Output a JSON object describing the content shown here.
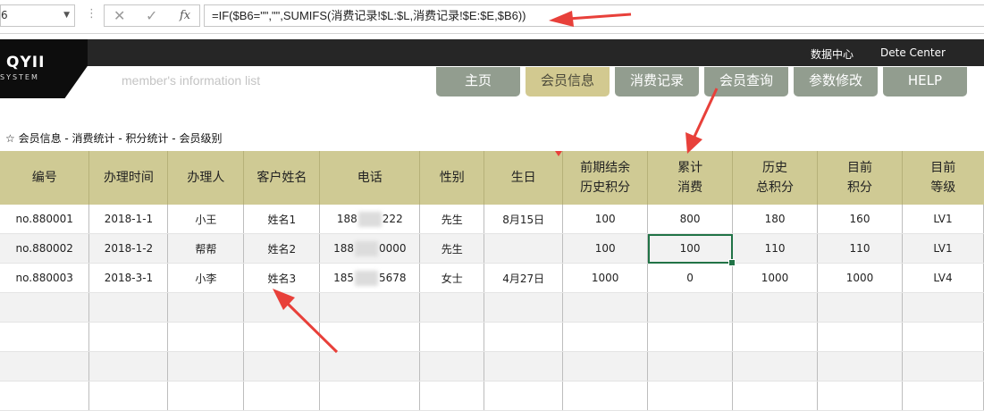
{
  "formula_bar": {
    "namebox_value": "6",
    "fx_label": "fx",
    "formula": "=IF($B6=\"\",\"\",SUMIFS(消费记录!$L:$L,消费记录!$E:$E,$B6))"
  },
  "header": {
    "logo_main": "QYII",
    "logo_sub": "SYSTEM",
    "links": [
      "数据中心",
      "Dete Center"
    ],
    "subtitle": "member's information list"
  },
  "nav": {
    "items": [
      "主页",
      "会员信息",
      "消费记录",
      "会员查询",
      "参数修改",
      "HELP"
    ],
    "active": "会员信息"
  },
  "breadcrumb": "☆  会员信息 - 消费统计 - 积分统计 - 会员级别",
  "table": {
    "columns": [
      "编号",
      "办理时间",
      "办理人",
      "客户姓名",
      "电话",
      "性别",
      "生日",
      "前期结余\n历史积分",
      "累计\n消费",
      "历史\n总积分",
      "目前\n积分",
      "目前\n等级"
    ],
    "rows": [
      {
        "id": "no.880001",
        "date": "2018-1-1",
        "handler": "小王",
        "name": "姓名1",
        "phone_a": "188",
        "phone_b": "222",
        "gender": "先生",
        "birthday": "8月15日",
        "prev": "100",
        "consume": "800",
        "total": "180",
        "points": "160",
        "level": "LV1"
      },
      {
        "id": "no.880002",
        "date": "2018-1-2",
        "handler": "帮帮",
        "name": "姓名2",
        "phone_a": "188",
        "phone_b": "0000",
        "gender": "先生",
        "birthday": "",
        "prev": "100",
        "consume": "100",
        "total": "110",
        "points": "110",
        "level": "LV1"
      },
      {
        "id": "no.880003",
        "date": "2018-3-1",
        "handler": "小李",
        "name": "姓名3",
        "phone_a": "185",
        "phone_b": "5678",
        "gender": "女士",
        "birthday": "4月27日",
        "prev": "1000",
        "consume": "0",
        "total": "1000",
        "points": "1000",
        "level": "LV4"
      }
    ]
  },
  "colors": {
    "header_bg": "#cfca94",
    "nav_bg": "#929d8f",
    "nav_active": "#d2c990",
    "arrow": "#e8403a",
    "selection": "#217346"
  }
}
